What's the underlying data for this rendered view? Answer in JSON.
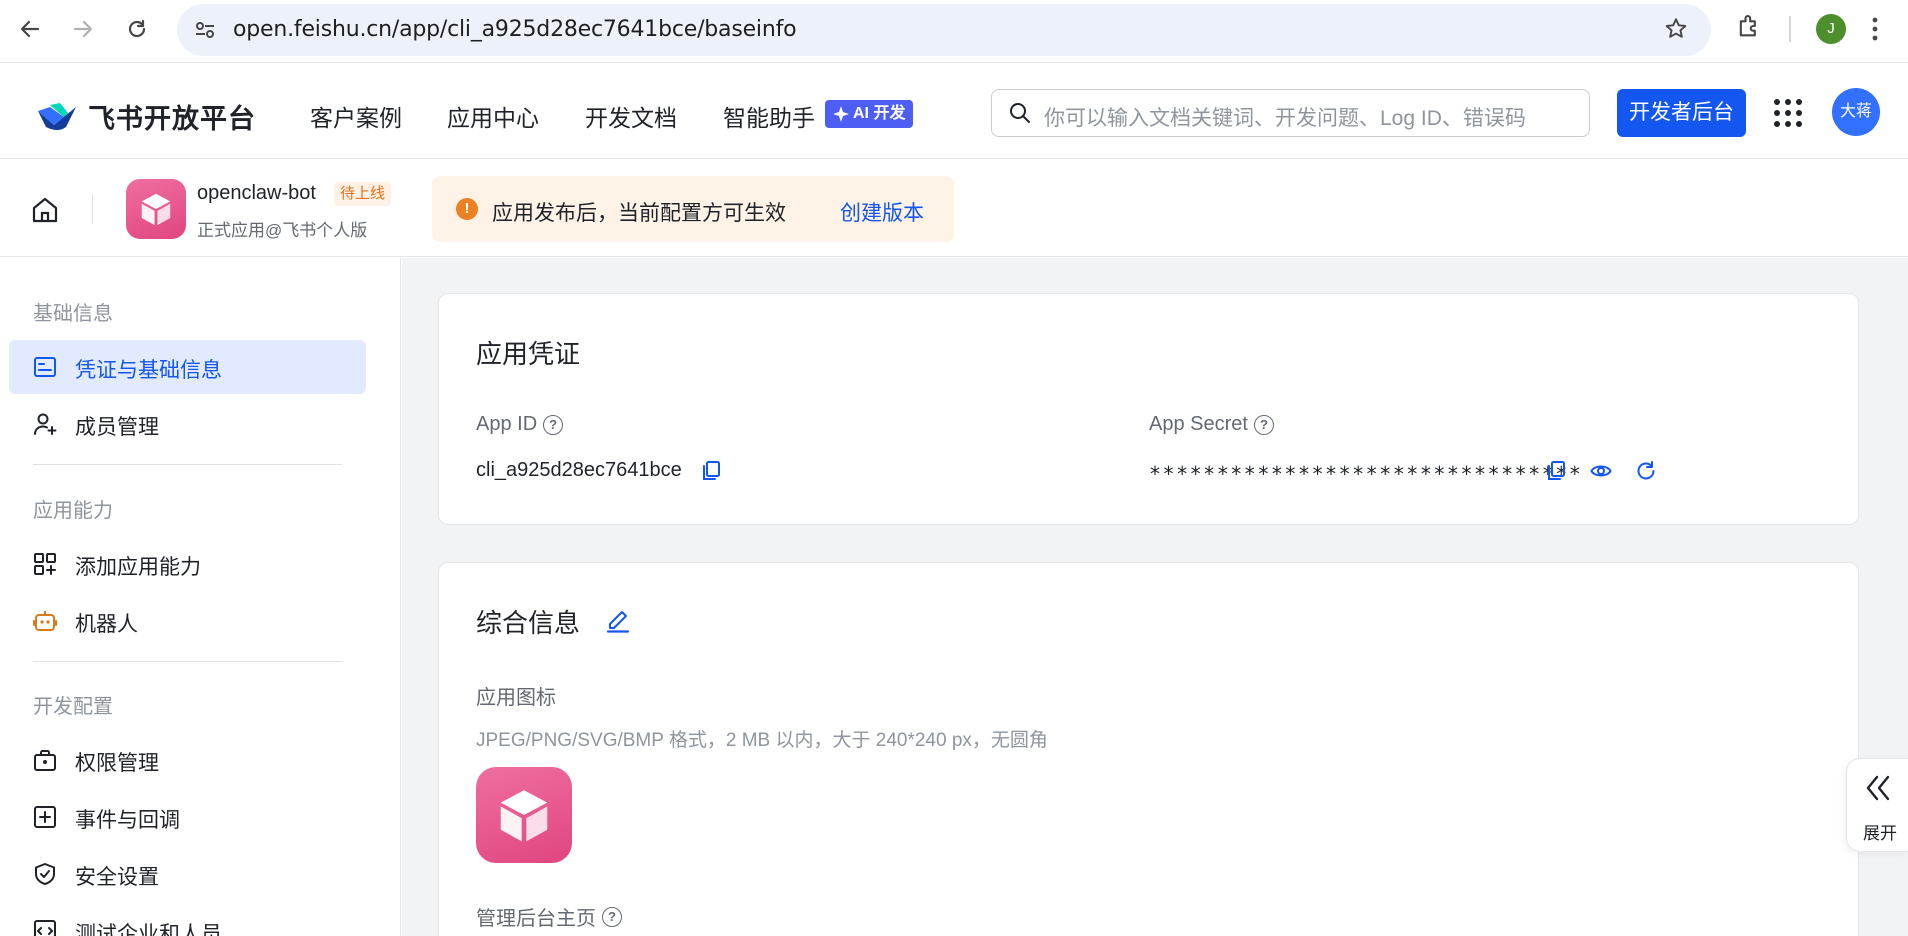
{
  "browser": {
    "url": "open.feishu.cn/app/cli_a925d28ec7641bce/baseinfo",
    "profile_initial": "J"
  },
  "header": {
    "logo_text": "飞书开放平台",
    "nav": [
      "客户案例",
      "应用中心",
      "开发文档",
      "智能助手"
    ],
    "ai_badge": "AI 开发",
    "search_placeholder": "你可以输入文档关键词、开发问题、Log ID、错误码",
    "dev_console_button": "开发者后台",
    "user_avatar": "大蒋"
  },
  "appbar": {
    "app_name": "openclaw-bot",
    "status_tag": "待上线",
    "app_subtitle": "正式应用@飞书个人版",
    "notice_text": "应用发布后，当前配置方可生效",
    "notice_link": "创建版本"
  },
  "sidebar": {
    "sections": [
      {
        "title": "基础信息",
        "items": [
          {
            "label": "凭证与基础信息",
            "icon": "credential-icon",
            "active": true
          },
          {
            "label": "成员管理",
            "icon": "user-add-icon"
          }
        ]
      },
      {
        "title": "应用能力",
        "items": [
          {
            "label": "添加应用能力",
            "icon": "apps-add-icon"
          },
          {
            "label": "机器人",
            "icon": "robot-icon"
          }
        ]
      },
      {
        "title": "开发配置",
        "items": [
          {
            "label": "权限管理",
            "icon": "permission-icon"
          },
          {
            "label": "事件与回调",
            "icon": "event-icon"
          },
          {
            "label": "安全设置",
            "icon": "shield-icon"
          },
          {
            "label": "测试企业和人员",
            "icon": "test-icon"
          }
        ]
      }
    ]
  },
  "credentials": {
    "title": "应用凭证",
    "app_id_label": "App ID",
    "app_id_value": "cli_a925d28ec7641bce",
    "app_secret_label": "App Secret",
    "app_secret_value": "********************************"
  },
  "general_info": {
    "title": "综合信息",
    "icon_label": "应用图标",
    "icon_hint": "JPEG/PNG/SVG/BMP 格式，2 MB 以内，大于 240*240 px，无圆角",
    "homepage_label": "管理后台主页"
  },
  "expand_panel": {
    "label": "展开"
  },
  "colors": {
    "primary": "#1456f0",
    "warning": "#ed8020",
    "app_icon": "#e85b91"
  }
}
